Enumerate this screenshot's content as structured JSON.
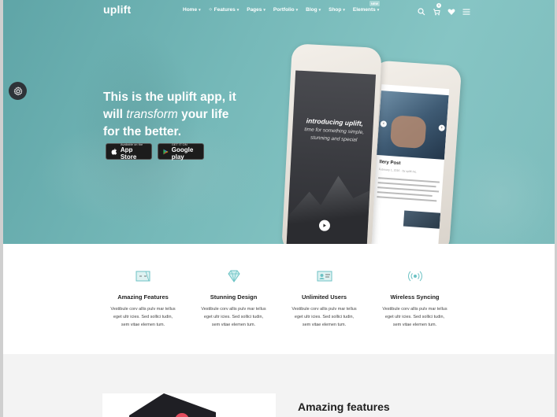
{
  "nav": {
    "logo": "uplift",
    "menu": [
      {
        "label": "Home"
      },
      {
        "label": "Features"
      },
      {
        "label": "Pages"
      },
      {
        "label": "Portfolio"
      },
      {
        "label": "Blog"
      },
      {
        "label": "Shop"
      },
      {
        "label": "Elements"
      }
    ],
    "new_badge": "NEW",
    "cart_count": "0"
  },
  "hero": {
    "title_line1": "This is the uplift app, it",
    "title_will": "will",
    "title_transform": "transform",
    "title_your_life": "your life",
    "title_line3": "for the better.",
    "app_store_small": "Available on the",
    "app_store_large": "App Store",
    "google_small": "GET IT ON",
    "google_large": "Google play"
  },
  "phone1": {
    "intro_title": "introducing uplift,",
    "intro_sub": "time for something simple, stunning and special"
  },
  "phone2": {
    "blog_title": "llery Post",
    "blog_meta": "February 1, 2016 · by uplift Inc."
  },
  "features": [
    {
      "name": "Amazing Features",
      "line1": "Vestibule corv allis pulv mar tellus",
      "line2": "eget ultr icies. Sed sollici tudin,",
      "line3": "sem vitae elemen tum."
    },
    {
      "name": "Stunning Design",
      "line1": "Vestibule corv allis pulv mar tellus",
      "line2": "eget ultr icies. Sed sollici tudin,",
      "line3": "sem vitae elemen tum."
    },
    {
      "name": "Unlimited Users",
      "line1": "Vestibule corv allis pulv mar tellus",
      "line2": "eget ultr icies. Sed sollici tudin,",
      "line3": "sem vitae elemen tum."
    },
    {
      "name": "Wireless Syncing",
      "line1": "Vestibule corv allis pulv mar tellus",
      "line2": "eget ultr icies. Sed sollici tudin,",
      "line3": "sem vitae elemen tum."
    }
  ],
  "lower": {
    "heading": "Amazing features"
  },
  "colors": {
    "accent": "#5fa5a7",
    "icon_teal": "#6cc2c4",
    "dark": "#2e3338"
  }
}
